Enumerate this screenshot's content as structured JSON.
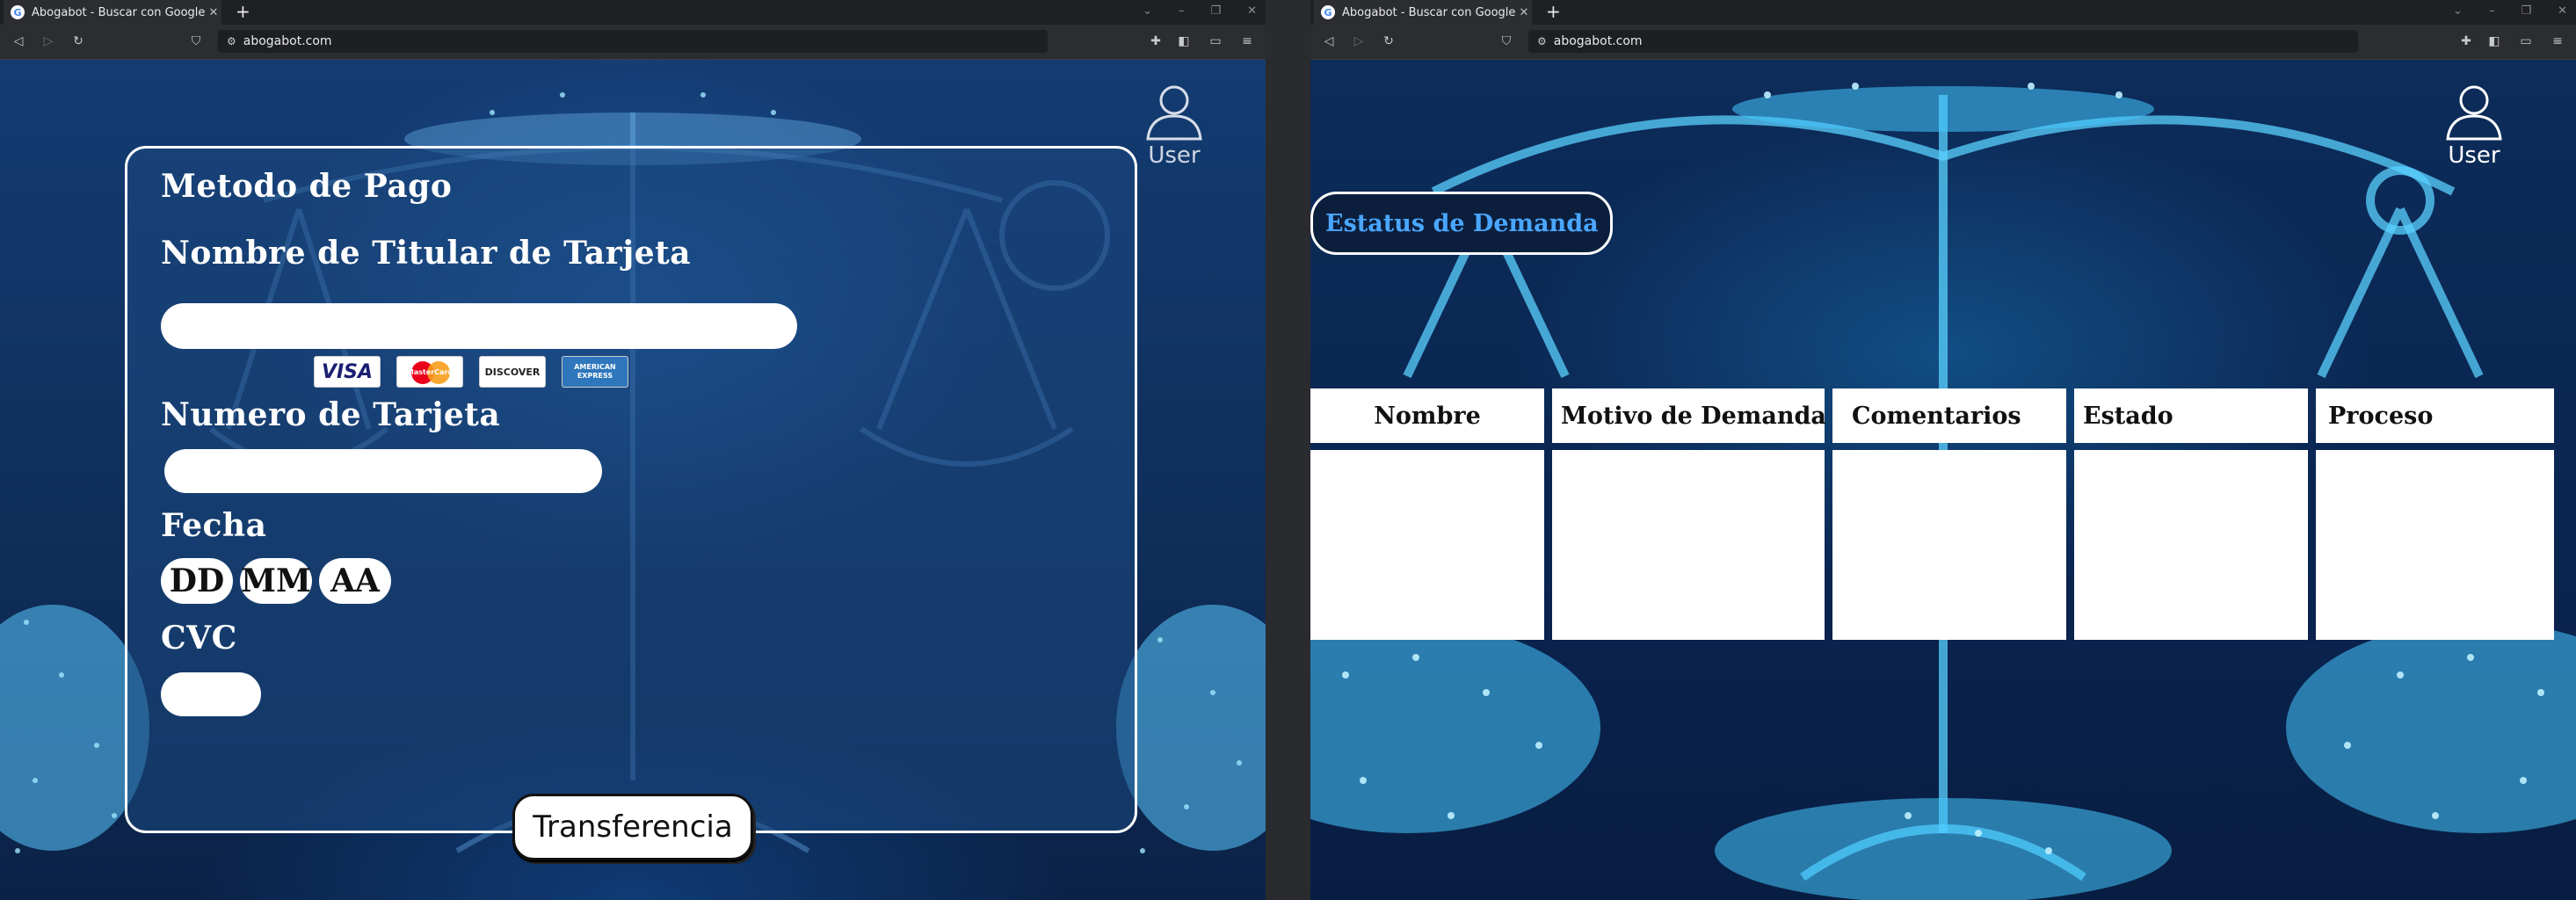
{
  "browser_left": {
    "tab_title": "Abogabot - Buscar con Google",
    "url": "abogabot.com"
  },
  "browser_right": {
    "tab_title": "Abogabot - Buscar con Google",
    "url": "abogabot.com"
  },
  "icons": {
    "favicon": "google-icon",
    "user": "user-outline-icon",
    "back": "arrow-left-icon",
    "forward": "arrow-right-icon",
    "reload": "reload-icon",
    "bookmark": "bookmark-icon",
    "site_info": "site-info-icon",
    "extensions": "puzzle-icon",
    "sidebar": "sidebar-icon",
    "media": "media-icon",
    "menu": "menu-icon"
  },
  "payment": {
    "title": "Metodo de Pago",
    "holder_label": "Nombre de Titular de Tarjeta",
    "holder_value": "",
    "cards": [
      "VISA",
      "MasterCard",
      "DISCOVER",
      "AMERICAN EXPRESS"
    ],
    "card_number_label": "Numero de Tarjeta",
    "card_number_value": "",
    "date_label": "Fecha",
    "date_day": "DD",
    "date_month": "MM",
    "date_year": "AA",
    "cvc_label": "CVC",
    "cvc_value": "",
    "transfer_button": "Transferencia"
  },
  "user": {
    "label": "User"
  },
  "status": {
    "title": "Estatus de Demanda",
    "columns": [
      "Nombre",
      "Motivo de Demanda",
      "Comentarios",
      "Estado",
      "Proceso"
    ],
    "rows": [
      [
        "",
        "",
        "",
        "",
        ""
      ]
    ]
  },
  "colors": {
    "page_bg": "#0f2f5b",
    "panel_border": "#ffffff",
    "status_title": "#4aa6ff",
    "chrome_bg": "#2c2d31"
  }
}
